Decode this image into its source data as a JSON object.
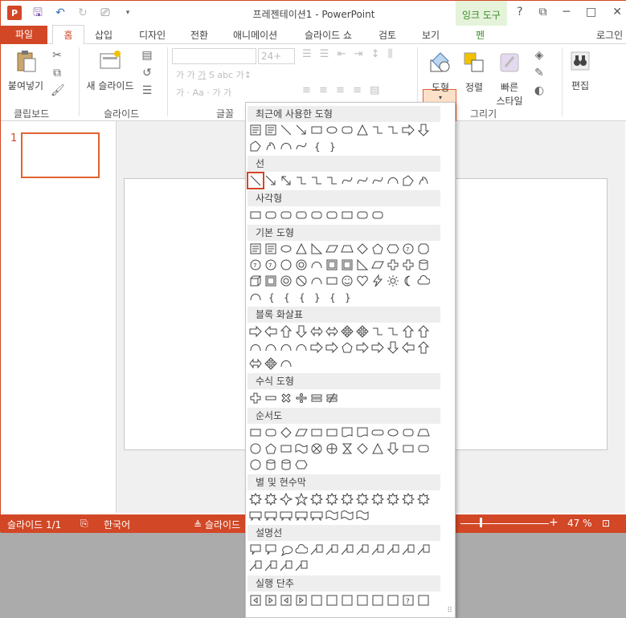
{
  "titlebar": {
    "app_title": "프레젠테이션1 - PowerPoint",
    "logo": "P",
    "ink_tab": "잉크 도구",
    "help": "?",
    "restore": "⧉",
    "minimize": "─",
    "maximize": "□",
    "close": "✕"
  },
  "tabs": {
    "file": "파일",
    "home": "홈",
    "insert": "삽입",
    "design": "디자인",
    "transitions": "전환",
    "animations": "애니메이션",
    "slideshow": "슬라이드 쇼",
    "review": "검토",
    "view": "보기",
    "pen": "펜",
    "login": "로그인"
  },
  "ribbon": {
    "paste": "붙여넣기",
    "clipboard_group": "클립보드",
    "new_slide": "새 슬라이드",
    "slides_group": "슬라이드",
    "font_size": "24+",
    "font_group": "글꼴",
    "shapes": "도형",
    "arrange": "정렬",
    "quick_styles_1": "빠른",
    "quick_styles_2": "스타일",
    "drawing_group": "그리기",
    "edit": "편집"
  },
  "thumbnail": {
    "number": "1"
  },
  "gallery": {
    "recent": "최근에 사용한 도형",
    "lines": "선",
    "rectangles": "사각형",
    "basic": "기본 도형",
    "block_arrows": "블록 화살표",
    "equation": "수식 도형",
    "flowchart": "순서도",
    "stars": "별 및 현수막",
    "callouts": "설명선",
    "action_buttons": "실행 단추"
  },
  "status": {
    "slide": "슬라이드 1/1",
    "language": "한국어",
    "notes": "슬라이드",
    "zoom": "47 %"
  },
  "colors": {
    "accent": "#d24726",
    "ink_tab_bg": "#e5f3da",
    "ink_tab_text": "#3c8c2c"
  }
}
